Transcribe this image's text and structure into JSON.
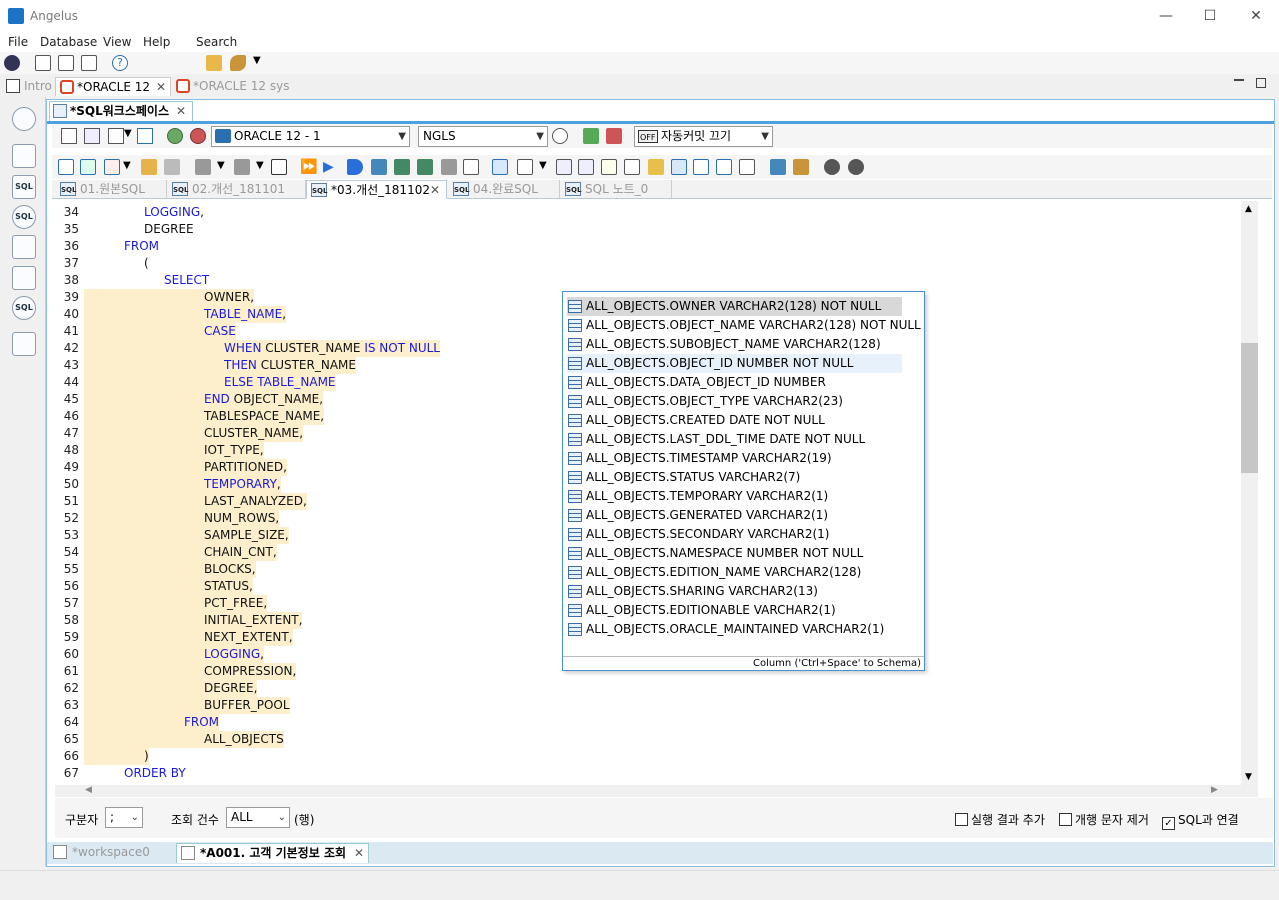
{
  "app": {
    "title": "Angelus"
  },
  "window_controls": {
    "minimize": "—",
    "maximize": "☐",
    "close": "✕"
  },
  "menu": [
    "File",
    "Database",
    "View",
    "Help",
    "Search"
  ],
  "outer_tabs": [
    {
      "label": "Intro"
    },
    {
      "label": "*ORACLE 12"
    },
    {
      "label": "*ORACLE 12 sys"
    }
  ],
  "workspace_tab": {
    "label": "*SQL워크스페이스"
  },
  "connection": {
    "name": "ORACLE 12 - 1",
    "nls": "NGLS",
    "autocommit": "자동커밋 끄기",
    "autocommit_badge": "OFF"
  },
  "sql_tabs": [
    {
      "label": "01.원본SQL"
    },
    {
      "label": "02.개선_181101"
    },
    {
      "label": "*03.개선_181102"
    },
    {
      "label": "04.완료SQL"
    },
    {
      "label": "SQL 노트_0"
    }
  ],
  "sql_icon_text": "SQL",
  "code_lines": [
    {
      "n": "34",
      "indent": 5,
      "tokens": [
        {
          "t": "LOGGING",
          "k": true
        },
        {
          "t": ",",
          "k": false
        }
      ]
    },
    {
      "n": "35",
      "indent": 5,
      "tokens": [
        {
          "t": "DEGREE",
          "k": false
        }
      ]
    },
    {
      "n": "36",
      "indent": 4,
      "tokens": [
        {
          "t": "FROM",
          "k": true
        }
      ]
    },
    {
      "n": "37",
      "indent": 5,
      "tokens": [
        {
          "t": "(",
          "k": false
        }
      ]
    },
    {
      "n": "38",
      "indent": 6,
      "tokens": [
        {
          "t": "SELECT",
          "k": true
        }
      ]
    },
    {
      "n": "39",
      "indent": 8,
      "hl": true,
      "tokens": [
        {
          "t": "OWNER,",
          "k": false
        }
      ]
    },
    {
      "n": "40",
      "indent": 8,
      "hl": true,
      "tokens": [
        {
          "t": "TABLE_NAME",
          "k": true
        },
        {
          "t": ",",
          "k": false
        }
      ]
    },
    {
      "n": "41",
      "indent": 8,
      "hl": true,
      "tokens": [
        {
          "t": "CASE",
          "k": true
        }
      ]
    },
    {
      "n": "42",
      "indent": 9,
      "hl": true,
      "tokens": [
        {
          "t": "WHEN ",
          "k": true
        },
        {
          "t": "CLUSTER_NAME ",
          "k": false
        },
        {
          "t": "IS NOT NULL",
          "k": true
        }
      ]
    },
    {
      "n": "43",
      "indent": 9,
      "hl": true,
      "tokens": [
        {
          "t": "THEN ",
          "k": true
        },
        {
          "t": "CLUSTER_NAME",
          "k": false
        }
      ]
    },
    {
      "n": "44",
      "indent": 9,
      "hl": true,
      "tokens": [
        {
          "t": "ELSE TABLE_NAME",
          "k": true
        }
      ]
    },
    {
      "n": "45",
      "indent": 8,
      "hl": true,
      "tokens": [
        {
          "t": "END ",
          "k": true
        },
        {
          "t": "OBJECT_NAME,",
          "k": false
        }
      ]
    },
    {
      "n": "46",
      "indent": 8,
      "hl": true,
      "tokens": [
        {
          "t": "TABLESPACE_NAME,",
          "k": false
        }
      ]
    },
    {
      "n": "47",
      "indent": 8,
      "hl": true,
      "tokens": [
        {
          "t": "CLUSTER_NAME,",
          "k": false
        }
      ]
    },
    {
      "n": "48",
      "indent": 8,
      "hl": true,
      "tokens": [
        {
          "t": "IOT_TYPE,",
          "k": false
        }
      ]
    },
    {
      "n": "49",
      "indent": 8,
      "hl": true,
      "tokens": [
        {
          "t": "PARTITIONED,",
          "k": false
        }
      ]
    },
    {
      "n": "50",
      "indent": 8,
      "hl": true,
      "tokens": [
        {
          "t": "TEMPORARY",
          "k": true
        },
        {
          "t": ",",
          "k": false
        }
      ]
    },
    {
      "n": "51",
      "indent": 8,
      "hl": true,
      "tokens": [
        {
          "t": "LAST_ANALYZED,",
          "k": false
        }
      ]
    },
    {
      "n": "52",
      "indent": 8,
      "hl": true,
      "tokens": [
        {
          "t": "NUM_ROWS,",
          "k": false
        }
      ]
    },
    {
      "n": "53",
      "indent": 8,
      "hl": true,
      "tokens": [
        {
          "t": "SAMPLE_SIZE,",
          "k": false
        }
      ]
    },
    {
      "n": "54",
      "indent": 8,
      "hl": true,
      "tokens": [
        {
          "t": "CHAIN_CNT,",
          "k": false
        }
      ]
    },
    {
      "n": "55",
      "indent": 8,
      "hl": true,
      "tokens": [
        {
          "t": "BLOCKS,",
          "k": false
        }
      ]
    },
    {
      "n": "56",
      "indent": 8,
      "hl": true,
      "tokens": [
        {
          "t": "STATUS,",
          "k": false
        }
      ]
    },
    {
      "n": "57",
      "indent": 8,
      "hl": true,
      "tokens": [
        {
          "t": "PCT_FREE,",
          "k": false
        }
      ]
    },
    {
      "n": "58",
      "indent": 8,
      "hl": true,
      "tokens": [
        {
          "t": "INITIAL_EXTENT,",
          "k": false
        }
      ]
    },
    {
      "n": "59",
      "indent": 8,
      "hl": true,
      "tokens": [
        {
          "t": "NEXT_EXTENT,",
          "k": false
        }
      ]
    },
    {
      "n": "60",
      "indent": 8,
      "hl": true,
      "tokens": [
        {
          "t": "LOGGING",
          "k": true
        },
        {
          "t": ",",
          "k": false
        }
      ]
    },
    {
      "n": "61",
      "indent": 8,
      "hl": true,
      "tokens": [
        {
          "t": "COMPRESSION,",
          "k": false
        }
      ]
    },
    {
      "n": "62",
      "indent": 8,
      "hl": true,
      "tokens": [
        {
          "t": "DEGREE,",
          "k": false
        }
      ]
    },
    {
      "n": "63",
      "indent": 8,
      "hl": true,
      "tokens": [
        {
          "t": "BUFFER_POOL",
          "k": false
        }
      ]
    },
    {
      "n": "64",
      "indent": 7,
      "hl": true,
      "tokens": [
        {
          "t": "FROM",
          "k": true
        }
      ]
    },
    {
      "n": "65",
      "indent": 8,
      "hl": true,
      "tokens": [
        {
          "t": "ALL_OBJECTS",
          "k": false
        }
      ]
    },
    {
      "n": "66",
      "indent": 5,
      "hl": true,
      "tokens": [
        {
          "t": ")",
          "k": false
        }
      ]
    },
    {
      "n": "67",
      "indent": 4,
      "tokens": [
        {
          "t": "ORDER BY",
          "k": true
        }
      ]
    }
  ],
  "autocomplete": {
    "items": [
      "ALL_OBJECTS.OWNER  VARCHAR2(128) NOT NULL",
      "ALL_OBJECTS.OBJECT_NAME  VARCHAR2(128) NOT NULL",
      "ALL_OBJECTS.SUBOBJECT_NAME  VARCHAR2(128)",
      "ALL_OBJECTS.OBJECT_ID  NUMBER NOT NULL",
      "ALL_OBJECTS.DATA_OBJECT_ID  NUMBER",
      "ALL_OBJECTS.OBJECT_TYPE  VARCHAR2(23)",
      "ALL_OBJECTS.CREATED  DATE NOT NULL",
      "ALL_OBJECTS.LAST_DDL_TIME  DATE NOT NULL",
      "ALL_OBJECTS.TIMESTAMP  VARCHAR2(19)",
      "ALL_OBJECTS.STATUS  VARCHAR2(7)",
      "ALL_OBJECTS.TEMPORARY  VARCHAR2(1)",
      "ALL_OBJECTS.GENERATED  VARCHAR2(1)",
      "ALL_OBJECTS.SECONDARY  VARCHAR2(1)",
      "ALL_OBJECTS.NAMESPACE  NUMBER NOT NULL",
      "ALL_OBJECTS.EDITION_NAME  VARCHAR2(128)",
      "ALL_OBJECTS.SHARING  VARCHAR2(13)",
      "ALL_OBJECTS.EDITIONABLE  VARCHAR2(1)",
      "ALL_OBJECTS.ORACLE_MAINTAINED  VARCHAR2(1)"
    ],
    "selected_index": 0,
    "hover_index": 3,
    "footer": "Column ('Ctrl+Space' to Schema)"
  },
  "bottom": {
    "separator_label": "구분자",
    "separator_value": ";",
    "fetch_label": "조회 건수",
    "fetch_value": "ALL",
    "fetch_unit": "(행)",
    "opt_append_result": "실행 결과 추가",
    "opt_remove_newline": "개행 문자 제거",
    "opt_link_sql": "SQL과 연결"
  },
  "bottom_tabs": [
    {
      "label": "*workspace0"
    },
    {
      "label": "*A001. 고객 기본정보 조회"
    }
  ],
  "colors": {
    "keyword": "#1a1adc",
    "highlight": "#fdefcc",
    "accent": "#4aa3df"
  }
}
